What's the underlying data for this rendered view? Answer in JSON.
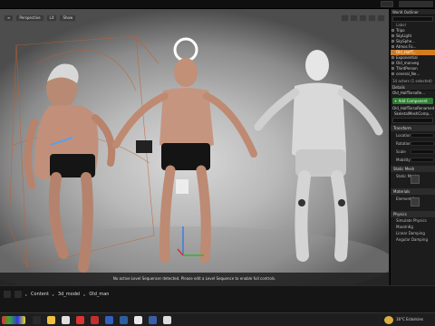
{
  "topbar": {
    "tab1": "",
    "window_controls": ""
  },
  "viewport": {
    "toolbar": {
      "menu_icon": "menu-icon",
      "perspective_label": "Perspective",
      "lit_label": "Lit",
      "show_label": "Show"
    },
    "status_message": "No active Level Sequencer detected. Please edit a Level Sequence to enable full controls."
  },
  "outliner": {
    "tab_label": "World Outliner",
    "second_tab": "Ma",
    "column_label": "Label",
    "rows": [
      {
        "label": "Tripo"
      },
      {
        "label": "SkyLight"
      },
      {
        "label": "SkySphe..."
      },
      {
        "label": "Atmos Fo..."
      },
      {
        "label": "Old_HalfT...",
        "selected": true
      },
      {
        "label": "Exponential"
      },
      {
        "label": "Old_manveg"
      },
      {
        "label": "ThirdPerson"
      },
      {
        "label": "ceneral_Ne..."
      }
    ],
    "actor_count": "14 actors (1 selected)"
  },
  "details": {
    "tab_label": "Details",
    "actor_name": "Old_HalfTorsoRe...",
    "add_component": "+ Add Component",
    "component_root": "Old_HalfTorsoRenamed",
    "component_child": "SkeletalMeshComp...",
    "search_placeholder": "Search",
    "transform_header": "Transform",
    "location_label": "Location",
    "rotation_label": "Rotation",
    "scale_label": "Scale",
    "mobility_label": "Mobility",
    "static_mesh_header": "Static Mesh",
    "static_mesh_label": "Static Mesh",
    "materials_header": "Materials",
    "element_label": "Element 0",
    "physics_header": "Physics",
    "simulate_label": "Simulate Physics",
    "mass_label": "MassInKg",
    "linear_label": "Linear Damping",
    "angular_label": "Angular Damping"
  },
  "content_browser": {
    "crumb1": "Content",
    "crumb2": "3d_model",
    "crumb3": "Old_man"
  },
  "taskbar": {
    "tray": "16°C  Eclaircies"
  }
}
